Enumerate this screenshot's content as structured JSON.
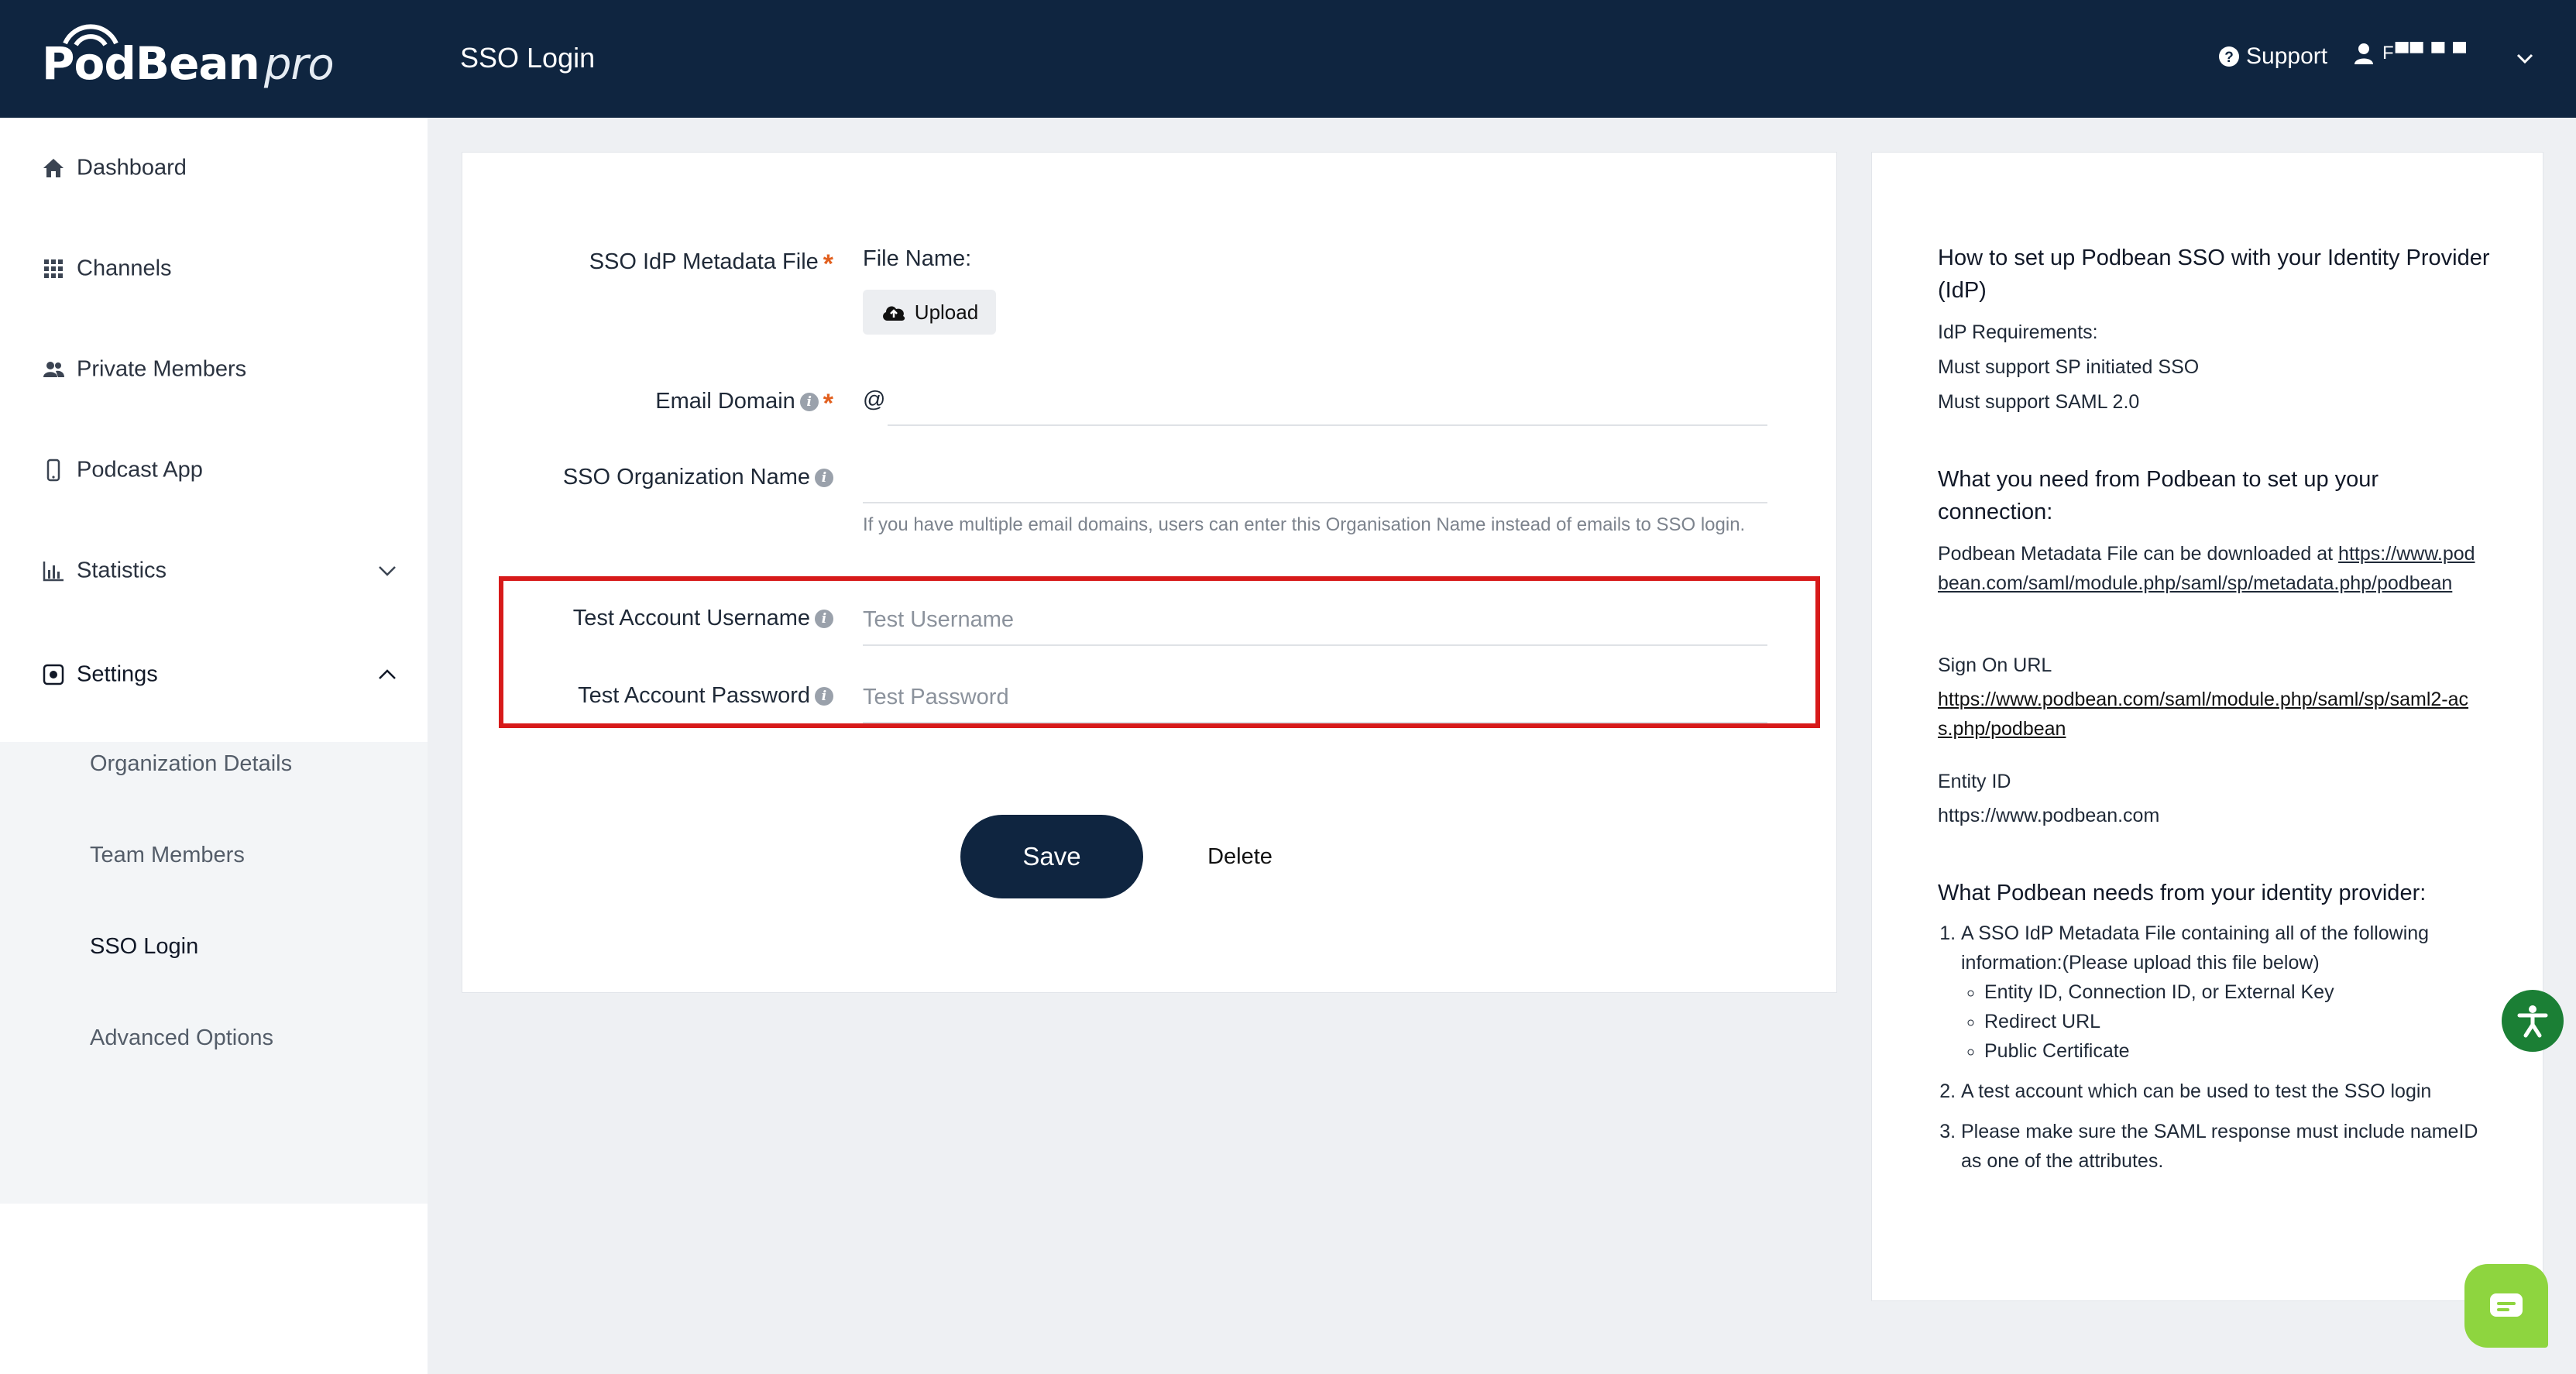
{
  "header": {
    "logo_word": "PodBean",
    "logo_pro": "pro",
    "page_title": "SSO Login",
    "support_label": "Support",
    "user_name": "F▀▀  ▀  ▀"
  },
  "sidebar": {
    "items": [
      {
        "label": "Dashboard",
        "icon": "home-icon"
      },
      {
        "label": "Channels",
        "icon": "grid-icon"
      },
      {
        "label": "Private Members",
        "icon": "users-icon"
      },
      {
        "label": "Podcast App",
        "icon": "phone-icon"
      },
      {
        "label": "Statistics",
        "icon": "bar-chart-icon"
      },
      {
        "label": "Settings",
        "icon": "settings-icon"
      }
    ],
    "settings_sub": [
      "Organization Details",
      "Team Members",
      "SSO Login",
      "Advanced Options"
    ],
    "active_sub": "SSO Login"
  },
  "form": {
    "metadata_label": "SSO IdP Metadata File",
    "file_name_label": "File Name:",
    "upload_label": "Upload",
    "email_domain_label": "Email Domain",
    "email_at": "@",
    "email_domain_value": "",
    "org_name_label": "SSO Organization Name",
    "org_name_value": "",
    "org_hint": "If you have multiple email domains, users can enter this Organisation Name instead of emails to SSO login.",
    "test_username_label": "Test Account Username",
    "test_username_placeholder": "Test Username",
    "test_password_label": "Test Account Password",
    "test_password_placeholder": "Test Password",
    "required_mark": "*",
    "save_label": "Save",
    "delete_label": "Delete"
  },
  "help": {
    "title": "How to set up Podbean SSO with your Identity Provider (IdP)",
    "req_heading": "IdP Requirements:",
    "req_1": "Must support SP initiated SSO",
    "req_2": "Must support SAML 2.0",
    "need_title": "What you need from Podbean to set up your connection:",
    "metadata_text": "Podbean Metadata File can be downloaded at ",
    "metadata_url": "https://www.podbean.com/saml/module.php/saml/sp/metadata.php/podbean",
    "sign_on_label": "Sign On URL",
    "sign_on_url": "https://www.podbean.com/saml/module.php/saml/sp/saml2-acs.php/podbean",
    "entity_label": "Entity ID",
    "entity_value": "https://www.podbean.com",
    "idp_title": "What Podbean needs from your identity provider:",
    "idp_1": "A SSO IdP Metadata File containing all of the following information:(Please upload this file below)",
    "idp_1_items": [
      "Entity ID, Connection ID, or External Key",
      "Redirect URL",
      "Public Certificate"
    ],
    "idp_2": "A test account which can be used to test the SSO login",
    "idp_3": "Please make sure the SAML response must include nameID as one of the attributes."
  },
  "colors": {
    "header_bg": "#0f2540",
    "accent_required": "#e2601f",
    "highlight": "#d71a1a",
    "a11y": "#1b7f35",
    "chat": "#8ed53f"
  }
}
